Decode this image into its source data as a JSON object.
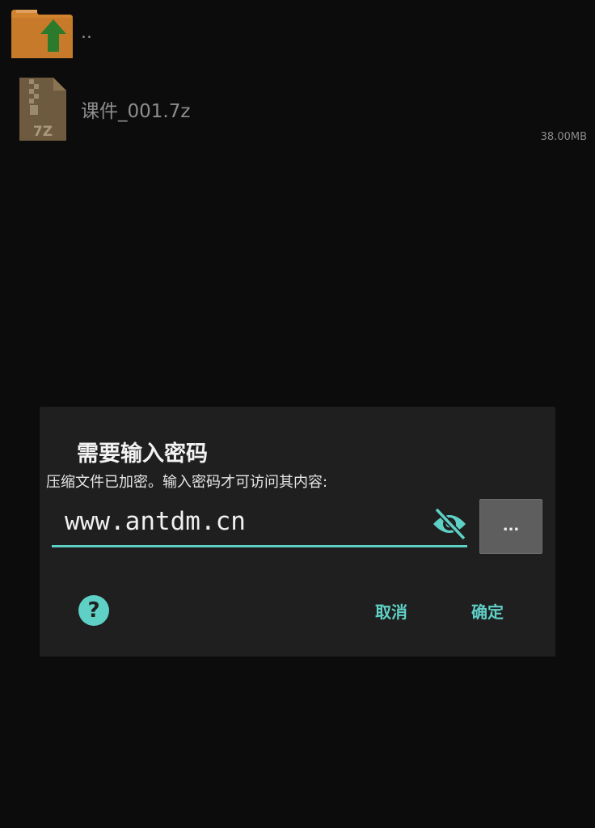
{
  "file_list": {
    "parent": {
      "name": "..",
      "icon": "folder-up-icon"
    },
    "files": [
      {
        "name": "课件_001.7z",
        "size": "38.00MB",
        "icon": "7z-archive-icon",
        "icon_label": "7Z"
      }
    ]
  },
  "dialog": {
    "title": "需要输入密码",
    "message": "压缩文件已加密。输入密码才可访问其内容:",
    "password_value": "www.antdm.cn",
    "visibility_icon": "eye-off-icon",
    "browse_label": "...",
    "help_label": "?",
    "cancel_label": "取消",
    "ok_label": "确定"
  },
  "colors": {
    "accent": "#5fd0c6",
    "dialog_bg": "#1f1f1f",
    "background": "#0c0c0c"
  }
}
